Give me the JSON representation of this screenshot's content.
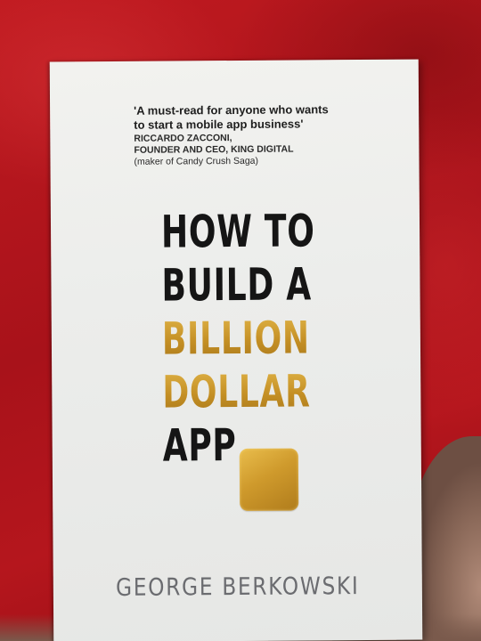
{
  "book": {
    "quote": {
      "text": "'A must-read for anyone who wants\nto start a mobile app business'",
      "attribution_lines": [
        "RICCARDO ZACCONI,",
        "FOUNDER AND CEO, KING DIGITAL",
        "(maker of Candy Crush Saga)"
      ]
    },
    "title_lines": [
      {
        "text": "HOW TO",
        "color": "#151515"
      },
      {
        "text": "BUILD A",
        "color": "#151515"
      },
      {
        "text": "BILLION",
        "color": "#c99a2e"
      },
      {
        "text": "DOLLAR",
        "color": "#c99a2e"
      },
      {
        "text": "APP",
        "color": "#151515"
      }
    ],
    "author": "GEORGE BERKOWSKI"
  },
  "colors": {
    "background_fabric": "#b3141a",
    "cover": "#ecedeb",
    "gold": "#c99a2e",
    "title_black": "#151515",
    "author_gray": "#6b6c70"
  }
}
